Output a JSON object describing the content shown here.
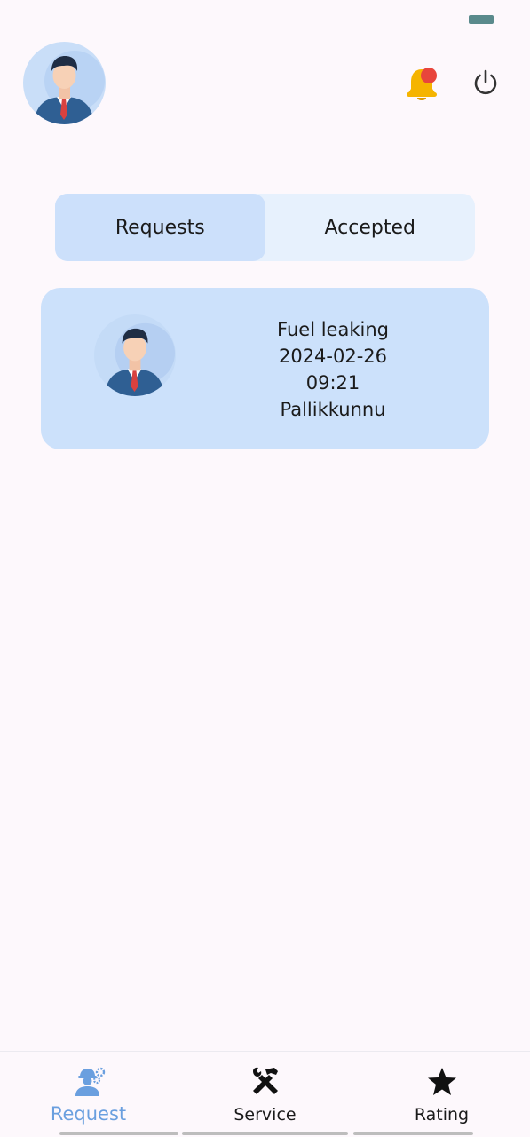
{
  "header": {
    "profile_avatar": "profile-avatar",
    "notification_icon": "bell-icon",
    "notification_badge_color": "#e8453c",
    "power_icon": "power-icon"
  },
  "tabs": [
    {
      "label": "Requests",
      "active": true
    },
    {
      "label": "Accepted",
      "active": false
    }
  ],
  "requests": [
    {
      "title": "Fuel leaking",
      "date": "2024-02-26",
      "time": "09:21",
      "location": "Pallikkunnu"
    }
  ],
  "bottom_nav": [
    {
      "label": "Request",
      "icon": "mechanic-icon",
      "active": true
    },
    {
      "label": "Service",
      "icon": "tools-icon",
      "active": false
    },
    {
      "label": "Rating",
      "icon": "star-icon",
      "active": false
    }
  ],
  "colors": {
    "accent": "#6a9fdf",
    "card_background": "#cce1fb",
    "tab_active": "#cce0fb",
    "tab_background": "#e7f1fd",
    "bell": "#f5b400"
  }
}
